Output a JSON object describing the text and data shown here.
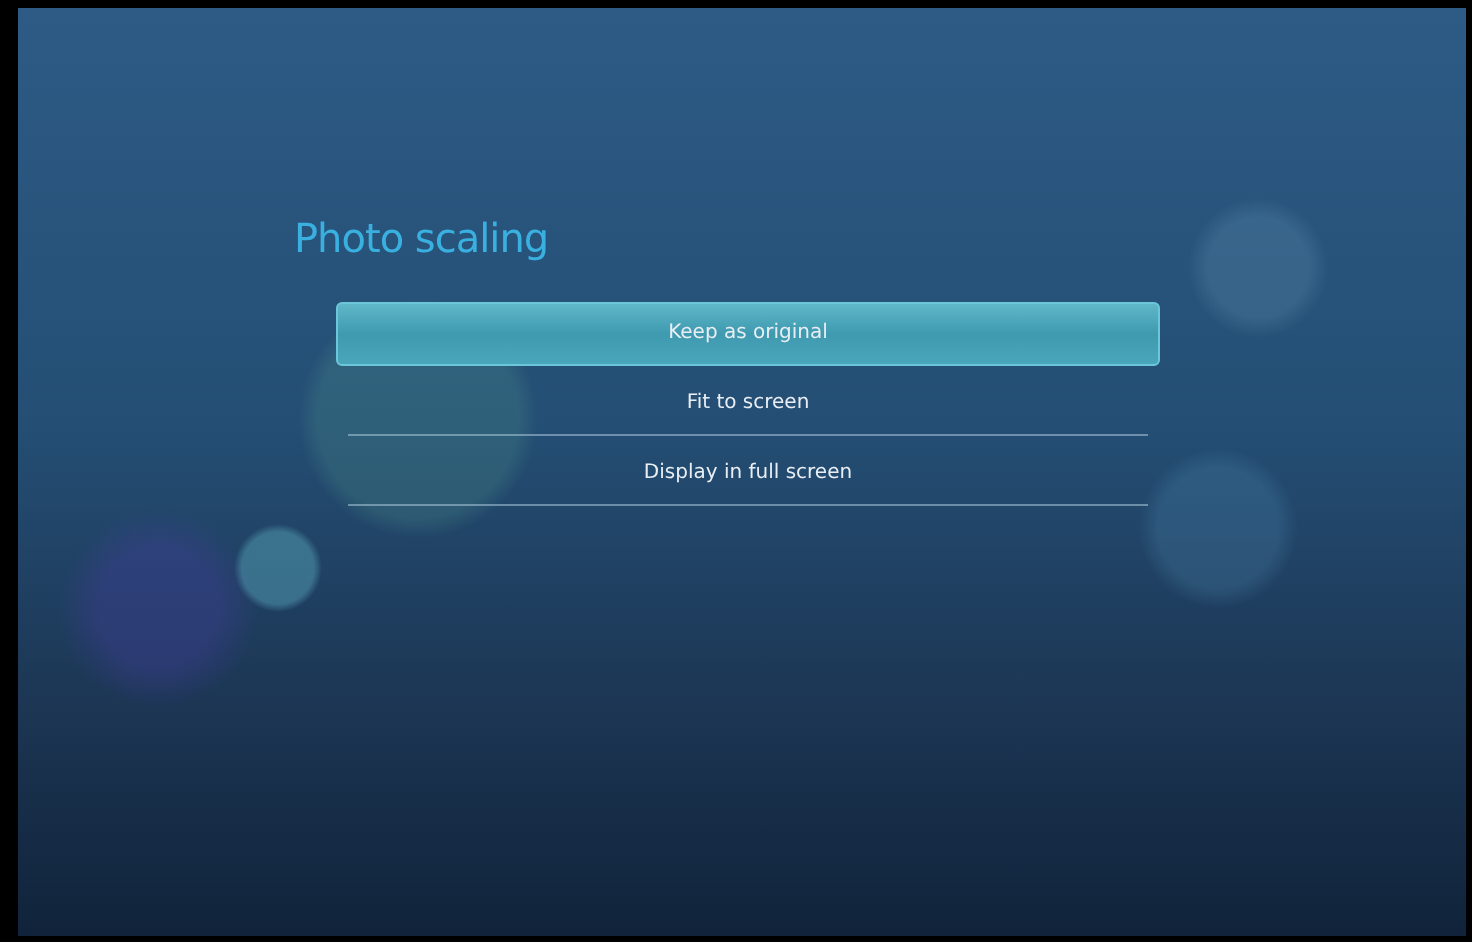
{
  "title": "Photo scaling",
  "options": [
    {
      "label": "Keep as original",
      "selected": true
    },
    {
      "label": "Fit to screen",
      "selected": false
    },
    {
      "label": "Display in full screen",
      "selected": false
    }
  ]
}
